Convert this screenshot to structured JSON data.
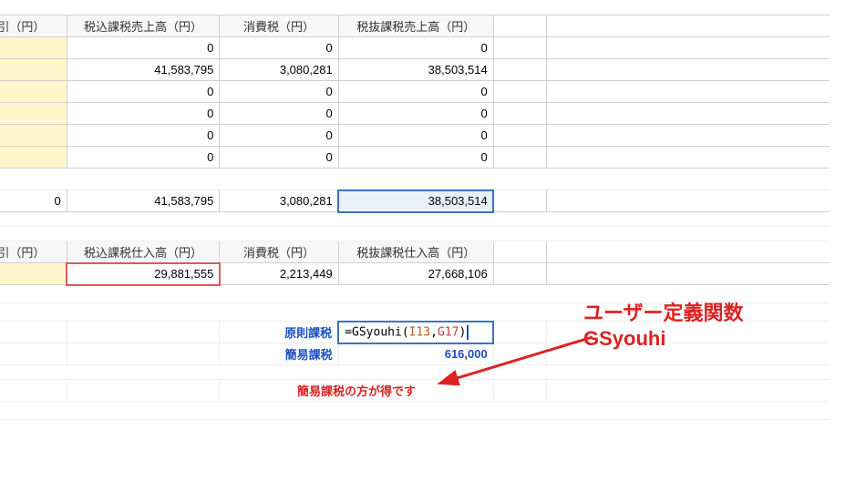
{
  "table1": {
    "headers": [
      "取引（円）",
      "税込課税売上高（円）",
      "消費税（円）",
      "税抜課税売上高（円）"
    ],
    "rows": [
      [
        "",
        "0",
        "0",
        "0"
      ],
      [
        "",
        "41,583,795",
        "3,080,281",
        "38,503,514"
      ],
      [
        "",
        "0",
        "0",
        "0"
      ],
      [
        "",
        "0",
        "0",
        "0"
      ],
      [
        "",
        "0",
        "0",
        "0"
      ],
      [
        "",
        "0",
        "0",
        "0"
      ]
    ],
    "totals": [
      "0",
      "41,583,795",
      "3,080,281",
      "38,503,514"
    ]
  },
  "table2": {
    "headers": [
      "取引（円）",
      "税込課税仕入高（円）",
      "消費税（円）",
      "税抜課税仕入高（円）"
    ],
    "rows": [
      [
        "",
        "29,881,555",
        "2,213,449",
        "27,668,106"
      ]
    ]
  },
  "calc": {
    "gensoku_label": "原則課税",
    "gensoku_formula_prefix": "=",
    "gensoku_formula_fn": "GSyouhi",
    "gensoku_formula_open": "(",
    "gensoku_formula_arg1": "I13",
    "gensoku_formula_comma": ",",
    "gensoku_formula_arg2": "G17",
    "gensoku_formula_close": ")",
    "kani_label": "簡易課税",
    "kani_value": "616,000",
    "tip": "簡易課税の方が得です"
  },
  "annotation": {
    "line1": "ユーザー定義関数",
    "line2": "GSyouhi"
  }
}
